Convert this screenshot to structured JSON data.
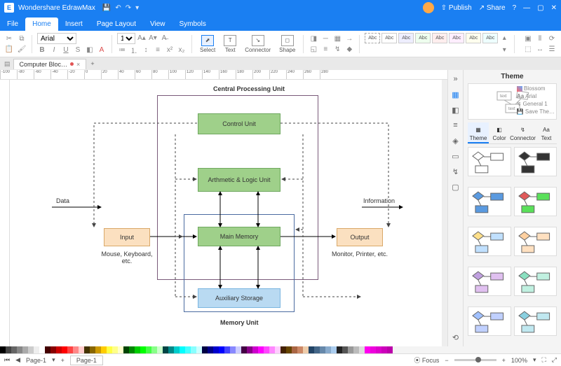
{
  "title": "Wondershare EdrawMax",
  "titlebar_right": {
    "publish": "Publish",
    "share": "Share"
  },
  "menu": [
    "File",
    "Home",
    "Insert",
    "Page Layout",
    "View",
    "Symbols"
  ],
  "menu_active": 1,
  "ribbon": {
    "font_name": "Arial",
    "font_size": "12",
    "tools": {
      "select": "Select",
      "text": "Text",
      "connector": "Connector",
      "shape": "Shape"
    },
    "swatch_label": "Abc"
  },
  "doc_tab": "Computer Bloc…",
  "diagram": {
    "title_top": "Central Processing Unit",
    "title_bottom": "Memory Unit",
    "control": "Control Unit",
    "alu": "Arthmetic & Logic Unit",
    "main_mem": "Main Memory",
    "aux": "Auxiliary Storage",
    "input": "Input",
    "output": "Output",
    "data": "Data",
    "info": "Information",
    "input_sub": "Mouse, Keyboard, etc.",
    "output_sub": "Monitor, Printer, etc."
  },
  "right_panel": {
    "title": "Theme",
    "preview_text": "text",
    "presets": [
      "Blossom",
      "Arial",
      "General 1",
      "Save The…"
    ],
    "tabs": [
      "Theme",
      "Color",
      "Connector",
      "Text"
    ],
    "active_tab": 0
  },
  "status": {
    "page_label": "Page-1",
    "page_tab": "Page-1",
    "focus": "Focus",
    "zoom": "100%"
  },
  "ruler_marks": [
    "-100",
    "-80",
    "-60",
    "-40",
    "-20",
    "0",
    "20",
    "40",
    "60",
    "80",
    "100",
    "120",
    "140",
    "160",
    "180",
    "200",
    "220",
    "240",
    "260",
    "280"
  ]
}
